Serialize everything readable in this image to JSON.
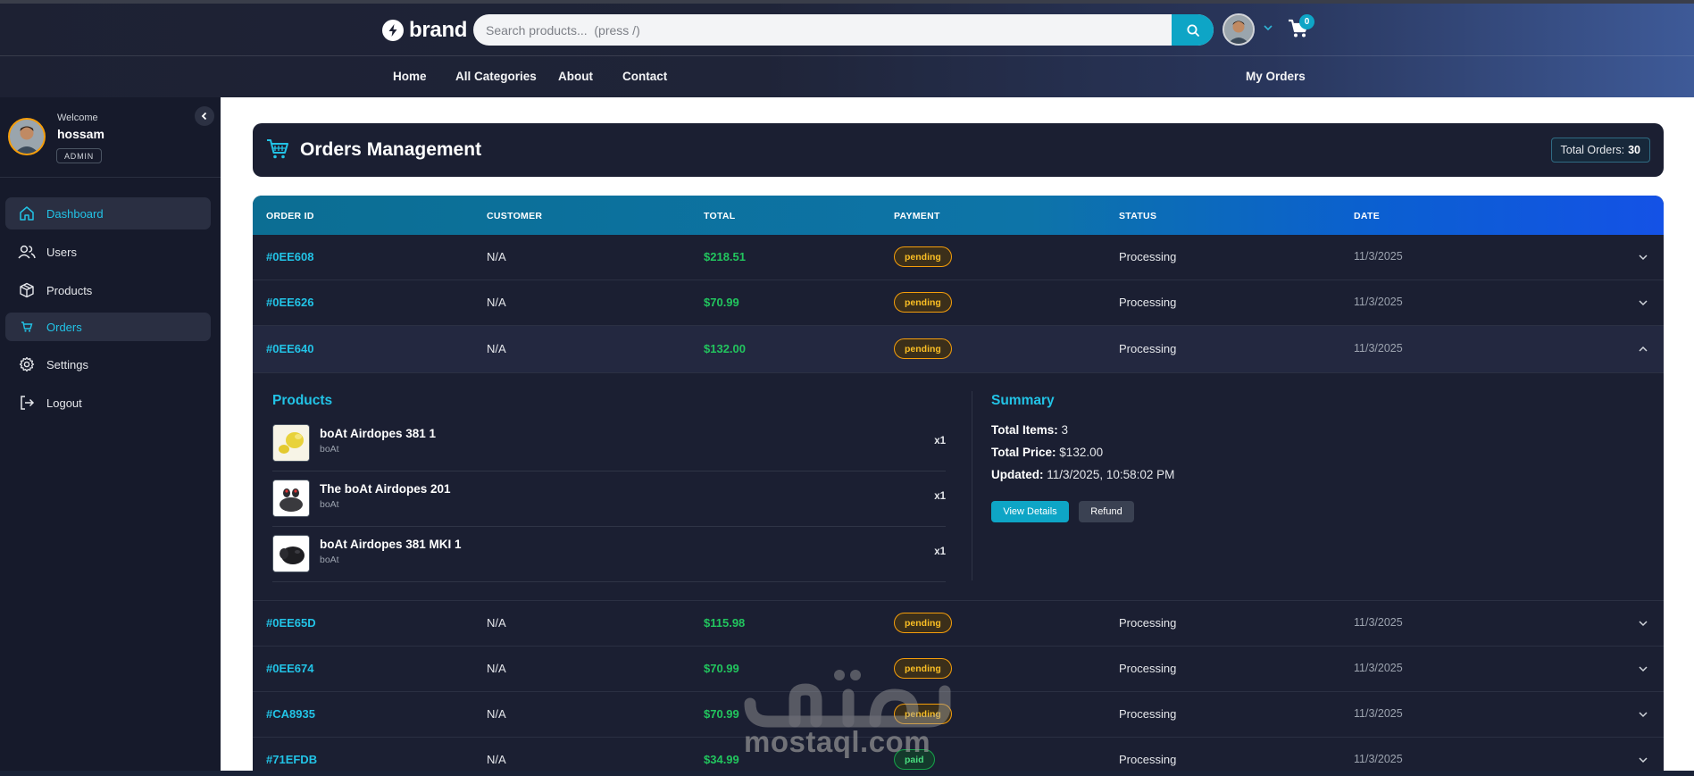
{
  "header": {
    "brand": "brand",
    "search_placeholder": "Search products...  (press /)",
    "cart_count": "0",
    "nav": [
      "Home",
      "All Categories",
      "About",
      "Contact"
    ],
    "my_orders": "My Orders"
  },
  "sidebar": {
    "welcome": "Welcome",
    "user_name": "hossam",
    "role": "ADMIN",
    "items": [
      {
        "label": "Dashboard",
        "icon": "home-icon"
      },
      {
        "label": "Users",
        "icon": "users-icon"
      },
      {
        "label": "Products",
        "icon": "box-icon"
      },
      {
        "label": "Orders",
        "icon": "cart-icon"
      },
      {
        "label": "Settings",
        "icon": "gear-icon"
      },
      {
        "label": "Logout",
        "icon": "logout-icon"
      }
    ]
  },
  "page": {
    "title": "Orders Management",
    "total_label": "Total Orders:",
    "total_value": "30"
  },
  "table": {
    "headers": [
      "ORDER ID",
      "CUSTOMER",
      "TOTAL",
      "PAYMENT",
      "STATUS",
      "DATE"
    ],
    "rows": [
      {
        "id": "#0EE608",
        "customer": "N/A",
        "total": "$218.51",
        "payment": "pending",
        "status": "Processing",
        "date": "11/3/2025"
      },
      {
        "id": "#0EE626",
        "customer": "N/A",
        "total": "$70.99",
        "payment": "pending",
        "status": "Processing",
        "date": "11/3/2025"
      },
      {
        "id": "#0EE640",
        "customer": "N/A",
        "total": "$132.00",
        "payment": "pending",
        "status": "Processing",
        "date": "11/3/2025"
      },
      {
        "id": "#0EE65D",
        "customer": "N/A",
        "total": "$115.98",
        "payment": "pending",
        "status": "Processing",
        "date": "11/3/2025"
      },
      {
        "id": "#0EE674",
        "customer": "N/A",
        "total": "$70.99",
        "payment": "pending",
        "status": "Processing",
        "date": "11/3/2025"
      },
      {
        "id": "#CA8935",
        "customer": "N/A",
        "total": "$70.99",
        "payment": "pending",
        "status": "Processing",
        "date": "11/3/2025"
      },
      {
        "id": "#71EFDB",
        "customer": "N/A",
        "total": "$34.99",
        "payment": "paid",
        "status": "Processing",
        "date": "11/3/2025"
      }
    ]
  },
  "details": {
    "products_title": "Products",
    "summary_title": "Summary",
    "products": [
      {
        "name": "boAt Airdopes 381 1",
        "brand": "boAt",
        "qty": "x1"
      },
      {
        "name": "The boAt Airdopes 201",
        "brand": "boAt",
        "qty": "x1"
      },
      {
        "name": "boAt Airdopes 381 MKI 1",
        "brand": "boAt",
        "qty": "x1"
      }
    ],
    "total_items_label": "Total Items:",
    "total_items": "3",
    "total_price_label": "Total Price:",
    "total_price": "$132.00",
    "updated_label": "Updated:",
    "updated": "11/3/2025, 10:58:02 PM",
    "view_details": "View Details",
    "refund": "Refund"
  },
  "watermark": "mostaql.com",
  "colors": {
    "accent": "#22c3e6",
    "success": "#22c55e",
    "warning": "#fbbf24"
  }
}
